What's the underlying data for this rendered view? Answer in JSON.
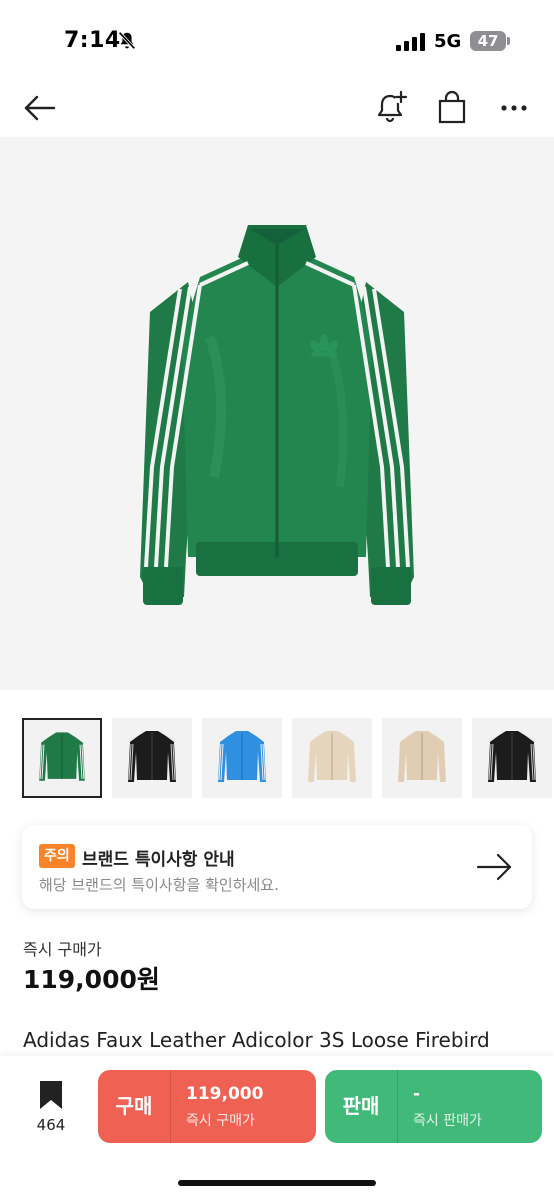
{
  "status_bar": {
    "time": "7:14",
    "network": "5G",
    "battery": "47",
    "icons": [
      "bell-slash-icon",
      "signal-icon",
      "battery-icon"
    ]
  },
  "nav": {
    "icons": [
      "back-arrow-icon",
      "bell-plus-icon",
      "shopping-bag-icon",
      "more-icon"
    ]
  },
  "hero": {
    "colors": {
      "jacket": "#1f7a47",
      "stripe": "#f2f2f2",
      "background": "#f4f4f4"
    }
  },
  "thumbnails": [
    {
      "color": "#1f7a47",
      "selected": true
    },
    {
      "color": "#1c1c1c",
      "selected": false
    },
    {
      "color": "#2f8fe0",
      "selected": false
    },
    {
      "color": "#e6d5bd",
      "selected": false
    },
    {
      "color": "#e1cdb4",
      "selected": false
    },
    {
      "color": "#1c1c1c",
      "selected": false
    }
  ],
  "notice": {
    "badge": "주의",
    "title": "브랜드 특이사항 안내",
    "subtitle": "해당 브랜드의 특이사항을 확인하세요."
  },
  "price": {
    "label": "즉시 구매가",
    "value": "119,000원"
  },
  "product": {
    "title": "Adidas Faux Leather Adicolor 3S Loose Firebird"
  },
  "bottom": {
    "bookmark_count": "464",
    "buy": {
      "label": "구매",
      "amount": "119,000",
      "sub": "즉시 구매가",
      "color": "#ef6253"
    },
    "sell": {
      "label": "판매",
      "amount": "-",
      "sub": "즉시 판매가",
      "color": "#41b979"
    }
  }
}
